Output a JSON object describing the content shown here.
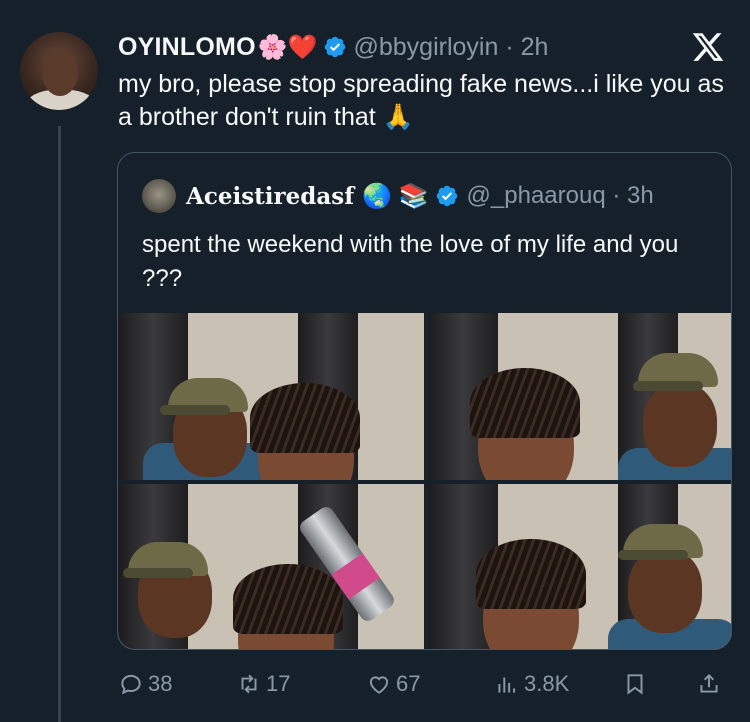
{
  "tweet": {
    "display_name": "OYINLOMO",
    "name_emoji": "🌸❤️",
    "handle_time": "@bbygirloyin · 2h",
    "text": "my bro, please stop spreading fake news...i like you as a brother don't ruin that 🙏",
    "accent_color": "#1d9bf0"
  },
  "quote": {
    "display_name": "Aceistiredasf",
    "name_emoji": "🌏 📚",
    "handle_time": "@_phaarouq · 3h",
    "text": "spent the weekend with the love of my life and you ???"
  },
  "actions": {
    "replies": "38",
    "retweets": "17",
    "likes": "67",
    "views": "3.8K"
  },
  "icons": [
    "x-logo-icon",
    "verified-badge-icon",
    "reply-icon",
    "retweet-icon",
    "like-icon",
    "views-icon",
    "bookmark-icon",
    "share-icon"
  ]
}
